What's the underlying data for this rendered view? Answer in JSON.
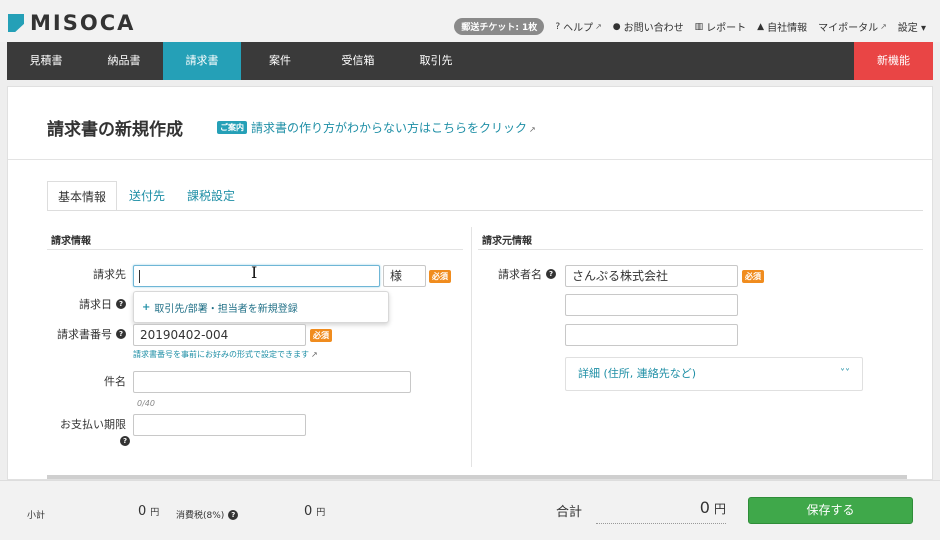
{
  "header": {
    "logo_text": "MISOCA",
    "ticket": "郵送チケット: 1枚",
    "links": [
      {
        "icon": "question-circle-icon",
        "glyph": "?",
        "label": "ヘルプ",
        "external": true
      },
      {
        "icon": "chat-bubble-icon",
        "glyph": "●",
        "label": "お問い合わせ",
        "external": false
      },
      {
        "icon": "bar-chart-icon",
        "glyph": "▥",
        "label": "レポート",
        "external": false
      },
      {
        "icon": "user-icon",
        "glyph": "▲",
        "label": "自社情報",
        "external": false
      },
      {
        "icon": "external-link-icon",
        "glyph": "",
        "label": "マイポータル",
        "external": true
      },
      {
        "icon": "caret-down-icon",
        "glyph": "",
        "label": "設定 ▾",
        "external": false
      }
    ]
  },
  "nav": {
    "items": [
      "見積書",
      "納品書",
      "請求書",
      "案件",
      "受信箱",
      "取引先"
    ],
    "active_index": 2,
    "new_feature": "新機能"
  },
  "page": {
    "title": "請求書の新規作成",
    "guide_badge": "ご案内",
    "guide_link": "請求書の作り方がわからない方はこちらをクリック"
  },
  "tabs": [
    "基本情報",
    "送付先",
    "課税設定"
  ],
  "invoice_info": {
    "section_title": "請求情報",
    "recipient_label": "請求先",
    "recipient_value": "",
    "honorific": "様",
    "required": "必須",
    "dropdown_option": "取引先/部署・担当者を新規登録",
    "date_label": "請求日",
    "number_label": "請求書番号",
    "number_value": "20190402-004",
    "number_hint": "請求書番号を事前にお好みの形式で設定できます",
    "subject_label": "件名",
    "subject_counter": "0/40",
    "due_label": "お支払い期限"
  },
  "issuer_info": {
    "section_title": "請求元情報",
    "name_label": "請求者名",
    "name_value": "さんぷる株式会社",
    "required": "必須",
    "details_label": "詳細 (住所, 連絡先など)",
    "details_toggle": "˅˅"
  },
  "footer": {
    "subtotal_label": "小計",
    "subtotal_value": "0",
    "tax_label": "消費税(8%)",
    "tax_value": "0",
    "unit": "円",
    "total_label": "合計",
    "total_value": "0",
    "save_label": "保存する"
  },
  "colors": {
    "accent": "#25a0b7",
    "nav_bg": "#3a3a3a",
    "new_feature_bg": "#e94545",
    "required_badge": "#f08c1e",
    "save_button": "#3fa84a"
  }
}
